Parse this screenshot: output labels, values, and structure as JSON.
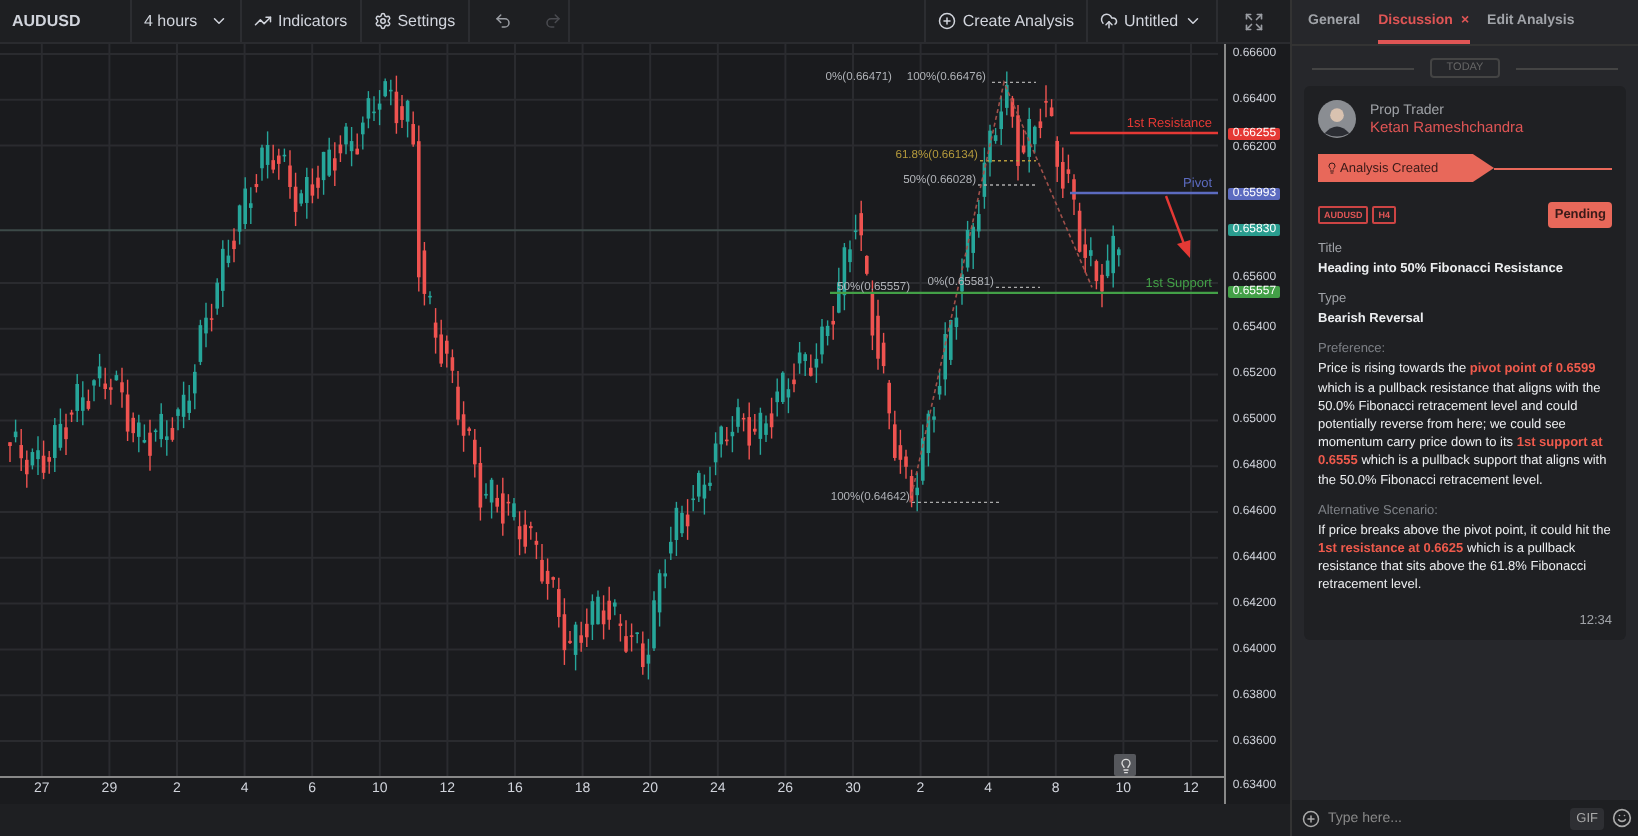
{
  "toolbar": {
    "symbol": "AUDUSD",
    "interval": "4 hours",
    "indicators": "Indicators",
    "settings": "Settings",
    "history": [
      {
        "kind": "undo",
        "disabled": false
      },
      {
        "kind": "redo",
        "disabled": true
      }
    ],
    "create_analysis": "Create Analysis",
    "layout_name": "Untitled"
  },
  "chart": {
    "price_ticks": [
      "0.66600",
      "0.66400",
      "0.66200",
      "0.65600",
      "0.65400",
      "0.65200",
      "0.65000",
      "0.64800",
      "0.64600",
      "0.64400",
      "0.64200",
      "0.64000",
      "0.63800",
      "0.63600",
      "0.63400"
    ],
    "time_ticks": [
      "27",
      "29",
      "2",
      "4",
      "6",
      "10",
      "12",
      "16",
      "18",
      "20",
      "24",
      "26",
      "30",
      "2",
      "4",
      "8",
      "10",
      "12"
    ],
    "current_price": "0.65830",
    "levels": [
      {
        "kind": "resistance",
        "label": "1st Resistance",
        "price": "0.66255",
        "color": "#e53935"
      },
      {
        "kind": "pivot",
        "label": "Pivot",
        "price": "0.65993",
        "color": "#5c6bc0"
      },
      {
        "kind": "support",
        "label": "1st Support",
        "price": "0.65557",
        "color": "#43a047"
      }
    ],
    "fib_labels": [
      {
        "text": "0%(0.66471)",
        "color": "#b0b3b8"
      },
      {
        "text": "100%(0.66476)",
        "color": "#b0b3b8"
      },
      {
        "text": "61.8%(0.66134)",
        "color": "#b59a3c"
      },
      {
        "text": "50%(0.66028)",
        "color": "#b0b3b8"
      },
      {
        "text": "0%(0.65581)",
        "color": "#b0b3b8"
      },
      {
        "text": "50%(0.65557)",
        "color": "#b0b3b8"
      },
      {
        "text": "100%(0.64642)",
        "color": "#b0b3b8"
      }
    ]
  },
  "panel": {
    "tabs": [
      {
        "label": "General",
        "selected": false
      },
      {
        "label": "Discussion",
        "selected": true,
        "close": "×"
      },
      {
        "label": "Edit Analysis",
        "selected": false
      }
    ],
    "day_divider": "TODAY",
    "post": {
      "role": "Prop Trader",
      "author": "Ketan Rameshchandra",
      "event": "Analysis Created",
      "tags": [
        "AUDUSD",
        "H4"
      ],
      "status": "Pending",
      "fields": [
        {
          "kind": "short",
          "label": "Title",
          "parts": [
            {
              "text": "Heading into 50% Fibonacci Resistance",
              "highlight": false
            }
          ]
        },
        {
          "kind": "short",
          "label": "Type",
          "parts": [
            {
              "text": "Bearish Reversal",
              "highlight": false
            }
          ]
        },
        {
          "kind": "paragraph",
          "label": "Preference:",
          "parts": [
            {
              "text": "Price is rising towards the ",
              "highlight": false
            },
            {
              "text": "pivot point of 0.6599",
              "highlight": true
            },
            {
              "text": " which is a pullback resistance that aligns with the 50.0% Fibonacci retracement level and could potentially reverse from here; we could see momentum carry price down to its ",
              "highlight": false
            },
            {
              "text": "1st support at 0.6555",
              "highlight": true
            },
            {
              "text": " which is a pullback support that aligns with the 50.0% Fibonacci retracement level.",
              "highlight": false
            }
          ]
        },
        {
          "kind": "paragraph",
          "label": "Alternative Scenario:",
          "parts": [
            {
              "text": "If price breaks above the pivot point, it could hit the ",
              "highlight": false
            },
            {
              "text": "1st resistance at 0.6625",
              "highlight": true
            },
            {
              "text": " which is a pullback resistance that sits above the 61.8% Fibonacci retracement level.",
              "highlight": false
            }
          ]
        }
      ],
      "time": "12:34"
    },
    "composer": {
      "placeholder": "Type here...",
      "gif": "GIF"
    }
  }
}
